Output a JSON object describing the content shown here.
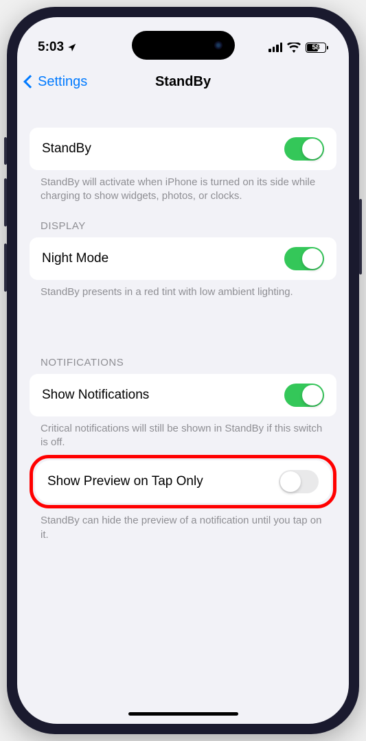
{
  "status": {
    "time": "5:03",
    "battery_percent": "58"
  },
  "nav": {
    "back_label": "Settings",
    "title": "StandBy"
  },
  "row_standby": {
    "label": "StandBy",
    "toggle_on": true,
    "footer": "StandBy will activate when iPhone is turned on its side while charging to show widgets, photos, or clocks."
  },
  "section_display": {
    "header": "DISPLAY"
  },
  "row_night_mode": {
    "label": "Night Mode",
    "toggle_on": true,
    "footer": "StandBy presents in a red tint with low ambient lighting."
  },
  "section_notifications": {
    "header": "NOTIFICATIONS"
  },
  "row_show_notifications": {
    "label": "Show Notifications",
    "toggle_on": true,
    "footer": "Critical notifications will still be shown in StandBy if this switch is off."
  },
  "row_show_preview": {
    "label": "Show Preview on Tap Only",
    "toggle_on": false,
    "footer": "StandBy can hide the preview of a notification until you tap on it."
  }
}
